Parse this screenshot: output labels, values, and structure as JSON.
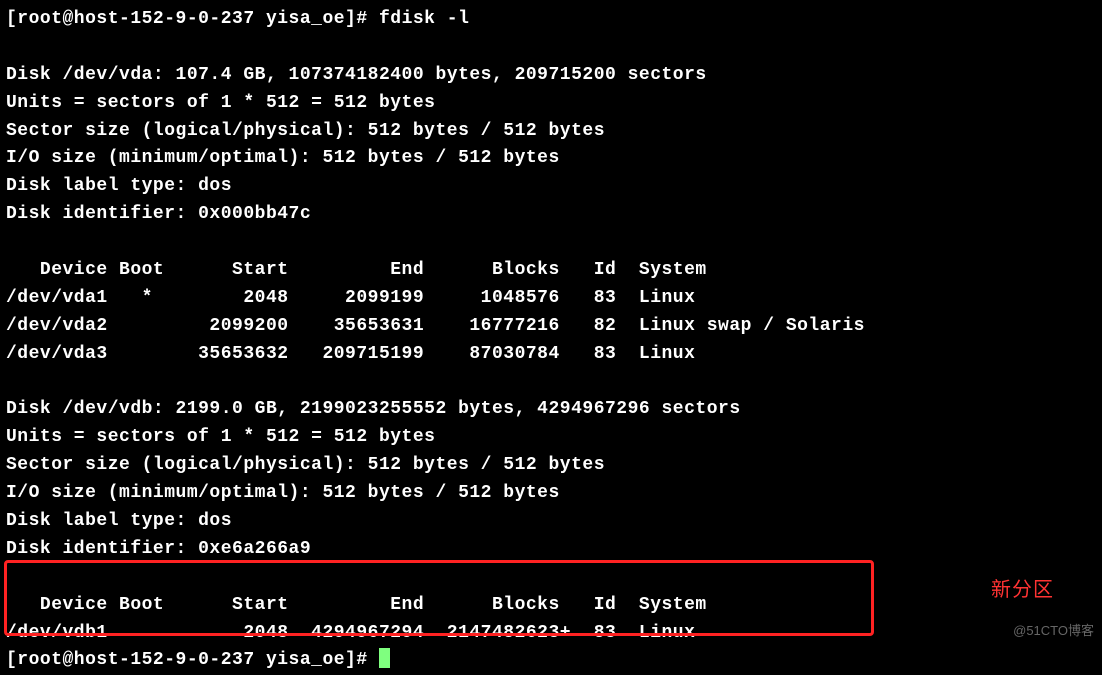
{
  "prompt1": {
    "user_host": "[root@host-152-9-0-237 yisa_oe]# ",
    "command": "fdisk -l"
  },
  "disk_vda": {
    "header": "Disk /dev/vda: 107.4 GB, 107374182400 bytes, 209715200 sectors",
    "units": "Units = sectors of 1 * 512 = 512 bytes",
    "sector_size": "Sector size (logical/physical): 512 bytes / 512 bytes",
    "io_size": "I/O size (minimum/optimal): 512 bytes / 512 bytes",
    "label_type": "Disk label type: dos",
    "identifier": "Disk identifier: 0x000bb47c",
    "columns": "   Device Boot      Start         End      Blocks   Id  System",
    "rows": [
      "/dev/vda1   *        2048     2099199     1048576   83  Linux",
      "/dev/vda2         2099200    35653631    16777216   82  Linux swap / Solaris",
      "/dev/vda3        35653632   209715199    87030784   83  Linux"
    ]
  },
  "disk_vdb": {
    "header": "Disk /dev/vdb: 2199.0 GB, 2199023255552 bytes, 4294967296 sectors",
    "units": "Units = sectors of 1 * 512 = 512 bytes",
    "sector_size": "Sector size (logical/physical): 512 bytes / 512 bytes",
    "io_size": "I/O size (minimum/optimal): 512 bytes / 512 bytes",
    "label_type": "Disk label type: dos",
    "identifier": "Disk identifier: 0xe6a266a9",
    "columns": "   Device Boot      Start         End      Blocks   Id  System",
    "rows": [
      "/dev/vdb1            2048  4294967294  2147482623+  83  Linux"
    ]
  },
  "prompt2": {
    "user_host": "[root@host-152-9-0-237 yisa_oe]# "
  },
  "annotation_label": "新分区",
  "watermark": "@51CTO博客"
}
